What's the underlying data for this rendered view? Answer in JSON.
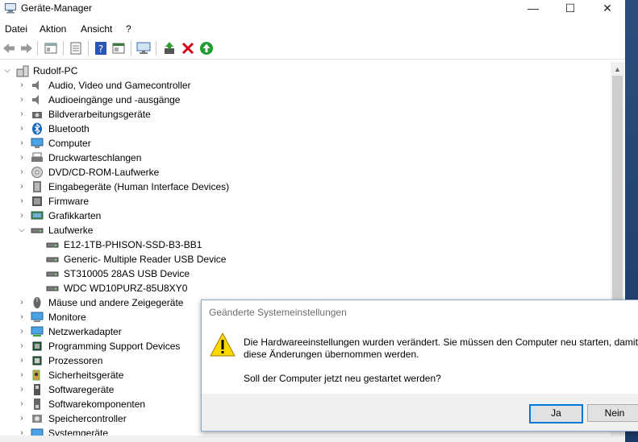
{
  "window": {
    "title": "Geräte-Manager",
    "controls": {
      "minimize": "—",
      "maximize": "☐",
      "close": "✕"
    }
  },
  "menu": [
    "Datei",
    "Aktion",
    "Ansicht",
    "?"
  ],
  "toolbar": {
    "icons": [
      "back-icon",
      "forward-icon",
      "properties-pane-icon",
      "list-view-icon",
      "help-icon",
      "details-view-icon",
      "monitor-scan-icon",
      "update-driver-icon",
      "uninstall-icon",
      "enable-device-icon"
    ]
  },
  "tree": {
    "root": "Rudolf-PC",
    "items": [
      {
        "label": "Audio, Video und Gamecontroller",
        "icon": "speaker-icon"
      },
      {
        "label": "Audioeingänge und -ausgänge",
        "icon": "speaker-icon"
      },
      {
        "label": "Bildverarbeitungsgeräte",
        "icon": "camera-icon"
      },
      {
        "label": "Bluetooth",
        "icon": "bluetooth-icon"
      },
      {
        "label": "Computer",
        "icon": "computer-icon"
      },
      {
        "label": "Druckwarteschlangen",
        "icon": "printer-icon"
      },
      {
        "label": "DVD/CD-ROM-Laufwerke",
        "icon": "dvd-icon"
      },
      {
        "label": "Eingabegeräte (Human Interface Devices)",
        "icon": "hid-icon"
      },
      {
        "label": "Firmware",
        "icon": "firmware-icon"
      },
      {
        "label": "Grafikkarten",
        "icon": "display-adapter-icon"
      },
      {
        "label": "Laufwerke",
        "icon": "drive-icon",
        "expanded": true
      },
      {
        "label": "E12-1TB-PHISON-SSD-B3-BB1",
        "icon": "drive-icon",
        "child": true
      },
      {
        "label": "Generic- Multiple Reader USB Device",
        "icon": "drive-icon",
        "child": true
      },
      {
        "label": "ST310005 28AS USB Device",
        "icon": "drive-icon",
        "child": true
      },
      {
        "label": "WDC WD10PURZ-85U8XY0",
        "icon": "drive-icon",
        "child": true
      },
      {
        "label": "Mäuse und andere Zeigegeräte",
        "icon": "mouse-icon"
      },
      {
        "label": "Monitore",
        "icon": "monitor-icon"
      },
      {
        "label": "Netzwerkadapter",
        "icon": "network-icon"
      },
      {
        "label": "Programming Support Devices",
        "icon": "chip-icon"
      },
      {
        "label": "Prozessoren",
        "icon": "processor-icon"
      },
      {
        "label": "Sicherheitsgeräte",
        "icon": "security-icon"
      },
      {
        "label": "Softwaregeräte",
        "icon": "software-device-icon"
      },
      {
        "label": "Softwarekomponenten",
        "icon": "software-component-icon"
      },
      {
        "label": "Speichercontroller",
        "icon": "storage-controller-icon"
      },
      {
        "label": "Systemgeräte",
        "icon": "system-device-icon"
      }
    ]
  },
  "dialog": {
    "title": "Geänderte Systemeinstellungen",
    "message": "Die Hardwareeinstellungen wurden verändert. Sie müssen den Computer neu starten, damit diese Änderungen übernommen werden.",
    "question": "Soll der Computer jetzt neu gestartet werden?",
    "yes_label": "Ja",
    "no_label": "Nein"
  }
}
